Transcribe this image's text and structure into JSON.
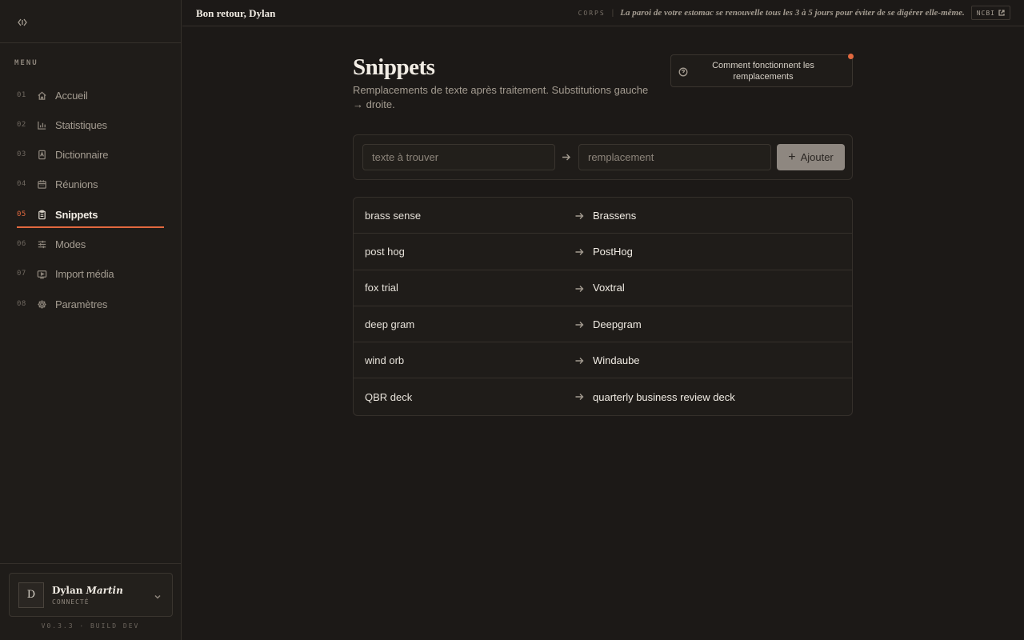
{
  "sidebar": {
    "menu_heading": "MENU",
    "items": [
      {
        "num": "01",
        "label": "Accueil",
        "icon": "home-icon"
      },
      {
        "num": "02",
        "label": "Statistiques",
        "icon": "bar-chart-icon"
      },
      {
        "num": "03",
        "label": "Dictionnaire",
        "icon": "book-icon"
      },
      {
        "num": "04",
        "label": "Réunions",
        "icon": "calendar-icon"
      },
      {
        "num": "05",
        "label": "Snippets",
        "icon": "clipboard-icon",
        "active": true
      },
      {
        "num": "06",
        "label": "Modes",
        "icon": "sliders-icon"
      },
      {
        "num": "07",
        "label": "Import média",
        "icon": "media-import-icon"
      },
      {
        "num": "08",
        "label": "Paramètres",
        "icon": "gear-icon"
      }
    ],
    "user": {
      "initial": "D",
      "first_name": "Dylan",
      "last_name": "Martin",
      "status": "CONNECTÉ"
    },
    "version": "V0.3.3 · BUILD DEV"
  },
  "topbar": {
    "greeting": "Bon retour, Dylan",
    "fact_tag": "CORPS",
    "fact_separator": "|",
    "fact_text": "La paroi de votre estomac se renouvelle tous les 3 à 5 jours pour éviter de se digérer elle-même.",
    "source_label": "NCBI"
  },
  "main": {
    "title": "Snippets",
    "subtitle": "Remplacements de texte après traitement. Substitutions gauche → droite.",
    "help_button": "Comment fonctionnent les remplacements",
    "add": {
      "find_placeholder": "texte à trouver",
      "replace_placeholder": "remplacement",
      "add_label": "Ajouter"
    },
    "snippets": [
      {
        "from": "brass sense",
        "to": "Brassens"
      },
      {
        "from": "post hog",
        "to": "PostHog"
      },
      {
        "from": "fox trial",
        "to": "Voxtral"
      },
      {
        "from": "deep gram",
        "to": "Deepgram"
      },
      {
        "from": "wind orb",
        "to": "Windaube"
      },
      {
        "from": "QBR deck",
        "to": "quarterly business review deck"
      }
    ]
  },
  "colors": {
    "background": "#1c1917",
    "accent": "#e2693f",
    "text": "#e7e2da",
    "muted": "#a49c91"
  }
}
